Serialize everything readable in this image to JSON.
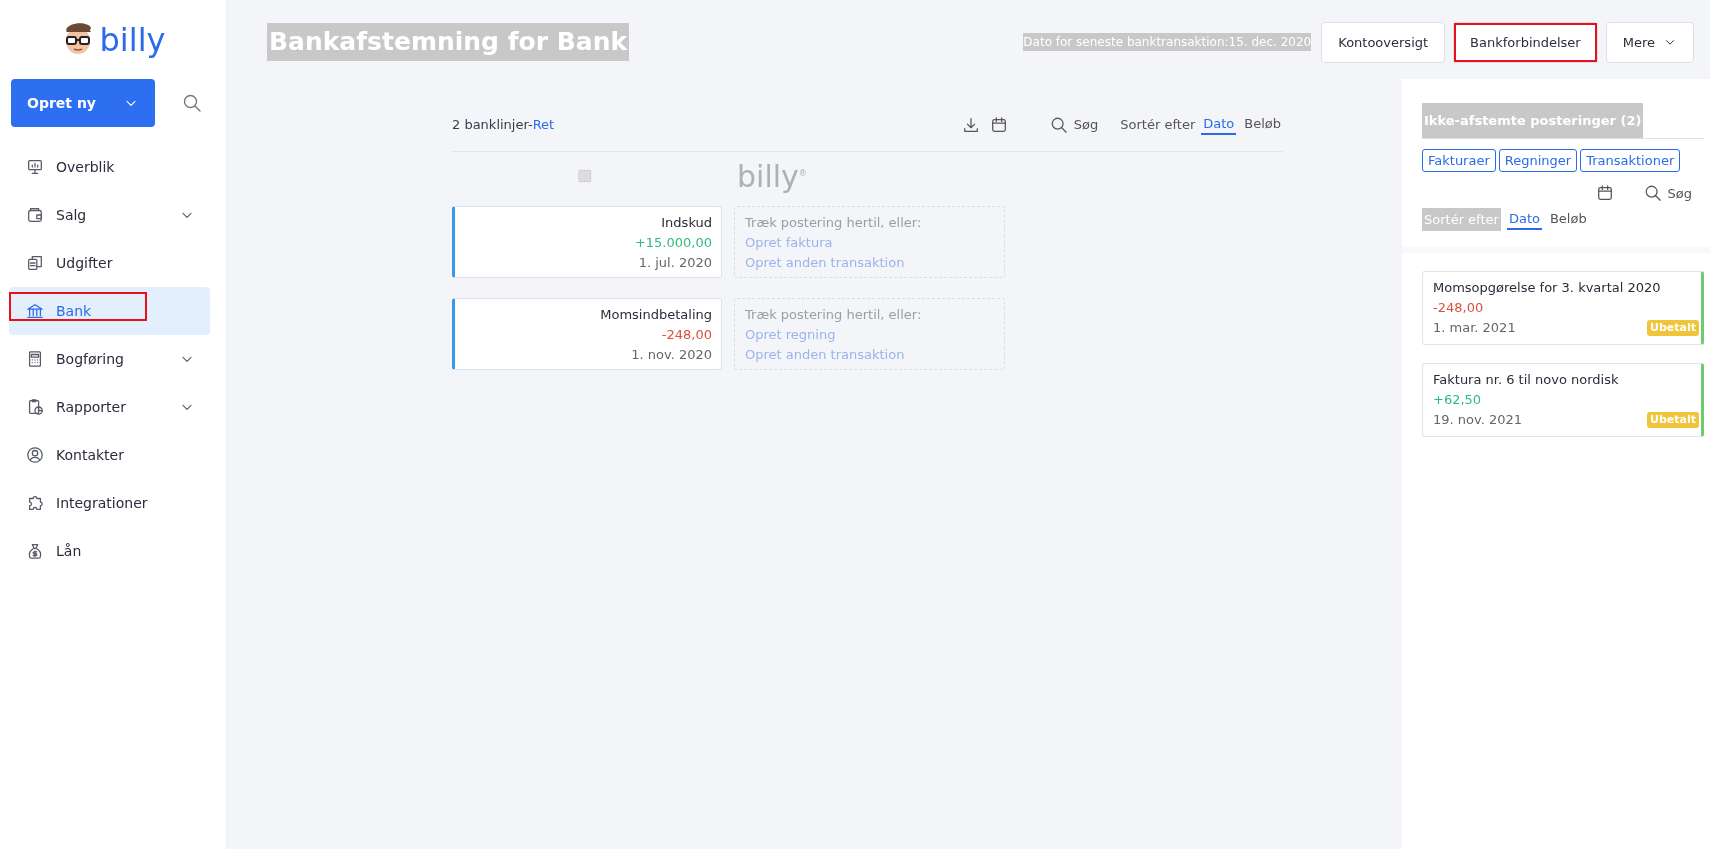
{
  "sidebar": {
    "logo": "billy",
    "create_button": "Opret ny",
    "items": [
      {
        "label": "Overblik",
        "selected": false,
        "expandable": false,
        "highlighted": false
      },
      {
        "label": "Salg",
        "selected": false,
        "expandable": true,
        "highlighted": false
      },
      {
        "label": "Udgifter",
        "selected": false,
        "expandable": false,
        "highlighted": false
      },
      {
        "label": "Bank",
        "selected": true,
        "expandable": false,
        "highlighted": true
      },
      {
        "label": "Bogføring",
        "selected": false,
        "expandable": true,
        "highlighted": false
      },
      {
        "label": "Rapporter",
        "selected": false,
        "expandable": true,
        "highlighted": false
      },
      {
        "label": "Kontakter",
        "selected": false,
        "expandable": false,
        "highlighted": false
      },
      {
        "label": "Integrationer",
        "selected": false,
        "expandable": false,
        "highlighted": false
      },
      {
        "label": "Lån",
        "selected": false,
        "expandable": false,
        "highlighted": false
      }
    ]
  },
  "header": {
    "title": "Bankafstemning for Bank",
    "last_transaction": "Dato for seneste banktransaktion:15. dec. 2020",
    "buttons": [
      {
        "label": "Kontooversigt",
        "highlighted": false,
        "dropdown": false
      },
      {
        "label": "Bankforbindelser",
        "highlighted": true,
        "dropdown": false
      },
      {
        "label": "Mere",
        "highlighted": false,
        "dropdown": true
      }
    ]
  },
  "bank_lines": {
    "count": "2 banklinjer-",
    "edit_link": "Ret",
    "search": "Søg",
    "sort_label": "Sortér efter",
    "sort_options": [
      {
        "label": "Dato",
        "selected": true
      },
      {
        "label": "Beløb",
        "selected": false
      }
    ],
    "watermark_logo": "billy$^{®}$",
    "rows": [
      {
        "title": "Indskud",
        "amount": "+15.000,00",
        "positive": true,
        "date": "1. jul. 2020",
        "hint": "Træk postering hertil, eller:",
        "actions": [
          "Opret faktura",
          "Opret anden transaktion"
        ]
      },
      {
        "title": "Momsindbetaling",
        "amount": "-248,00",
        "positive": false,
        "date": "1. nov. 2020",
        "hint": "Træk postering hertil, eller:",
        "actions": [
          "Opret regning",
          "Opret anden transaktion"
        ]
      }
    ]
  },
  "unreconciled": {
    "title": "Ikke-afstemte posteringer (2)",
    "filters": [
      "Fakturaer",
      "Regninger",
      "Transaktioner"
    ],
    "search": "Søg",
    "sort_label": "Sortér efter",
    "sort_options": [
      {
        "label": "Dato",
        "selected": true
      },
      {
        "label": "Beløb",
        "selected": false
      }
    ],
    "items": [
      {
        "title": "Momsopgørelse for 3. kvartal 2020",
        "amount": "-248,00",
        "positive": false,
        "date": "1. mar. 2021",
        "status": "Ubetalt"
      },
      {
        "title": "Faktura nr. 6 til novo nordisk",
        "amount": "+62,50",
        "positive": true,
        "date": "19. nov. 2021",
        "status": "Ubetalt"
      }
    ]
  }
}
